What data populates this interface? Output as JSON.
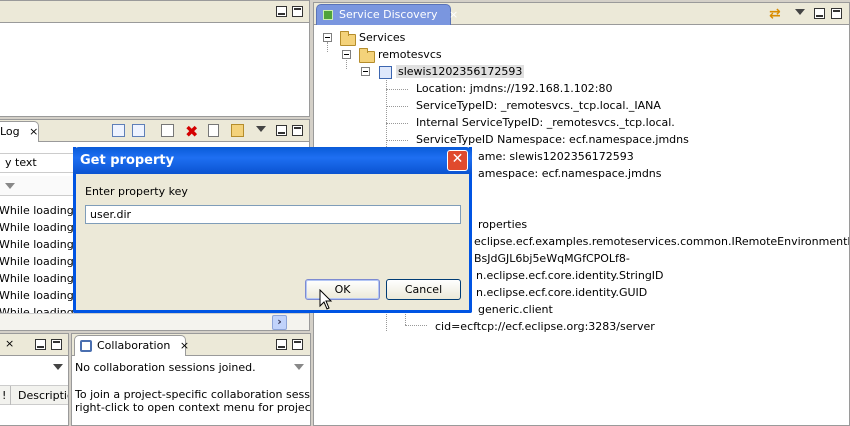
{
  "top_left_view": {},
  "log_view": {
    "tab_label": "Log",
    "filter_value": "y text",
    "rows": [
      "While loading clas",
      "While loading clas",
      "While loading clas",
      "While loading clas",
      "While loading clas",
      "While loading clas",
      "While loading clas"
    ]
  },
  "tasks_view": {
    "column_1": "!",
    "column_2": "Descriptio"
  },
  "collaboration_view": {
    "tab_label": "Collaboration",
    "line1": "No collaboration sessions joined.",
    "line2": "To join a project-specific collaboration session, se",
    "line3": "right-click to open context menu for project, and"
  },
  "service_discovery": {
    "tab_label": "Service Discovery",
    "tree": {
      "root": "Services",
      "child": "remotesvcs",
      "host": "slewis1202356172593",
      "details": [
        "Location: jmdns://192.168.1.102:80",
        "ServiceTypeID: _remotesvcs._tcp.local._IANA",
        "Internal ServiceTypeID: _remotesvcs._tcp.local.",
        "ServiceTypeID Namespace: ecf.namespace.jmdns",
        "ame: slewis1202356172593",
        "amespace: ecf.namespace.jmdns"
      ],
      "props_header": "roperties",
      "props": [
        "eclipse.ecf.examples.remoteservices.common.IRemoteEnvironmentInfo",
        "BsJdGJL6bj5eWqMGfCPOLf8-",
        "n.eclipse.ecf.core.identity.StringID",
        "n.eclipse.ecf.core.identity.GUID",
        "generic.client"
      ],
      "cid": "cid=ecftcp://ecf.eclipse.org:3283/server"
    }
  },
  "dialog": {
    "title": "Get property",
    "prompt": "Enter property key",
    "value": "user.dir",
    "ok_label": "OK",
    "cancel_label": "Cancel",
    "close_glyph": "✕"
  },
  "icons": {
    "close": "×",
    "arrow_right": "›"
  }
}
